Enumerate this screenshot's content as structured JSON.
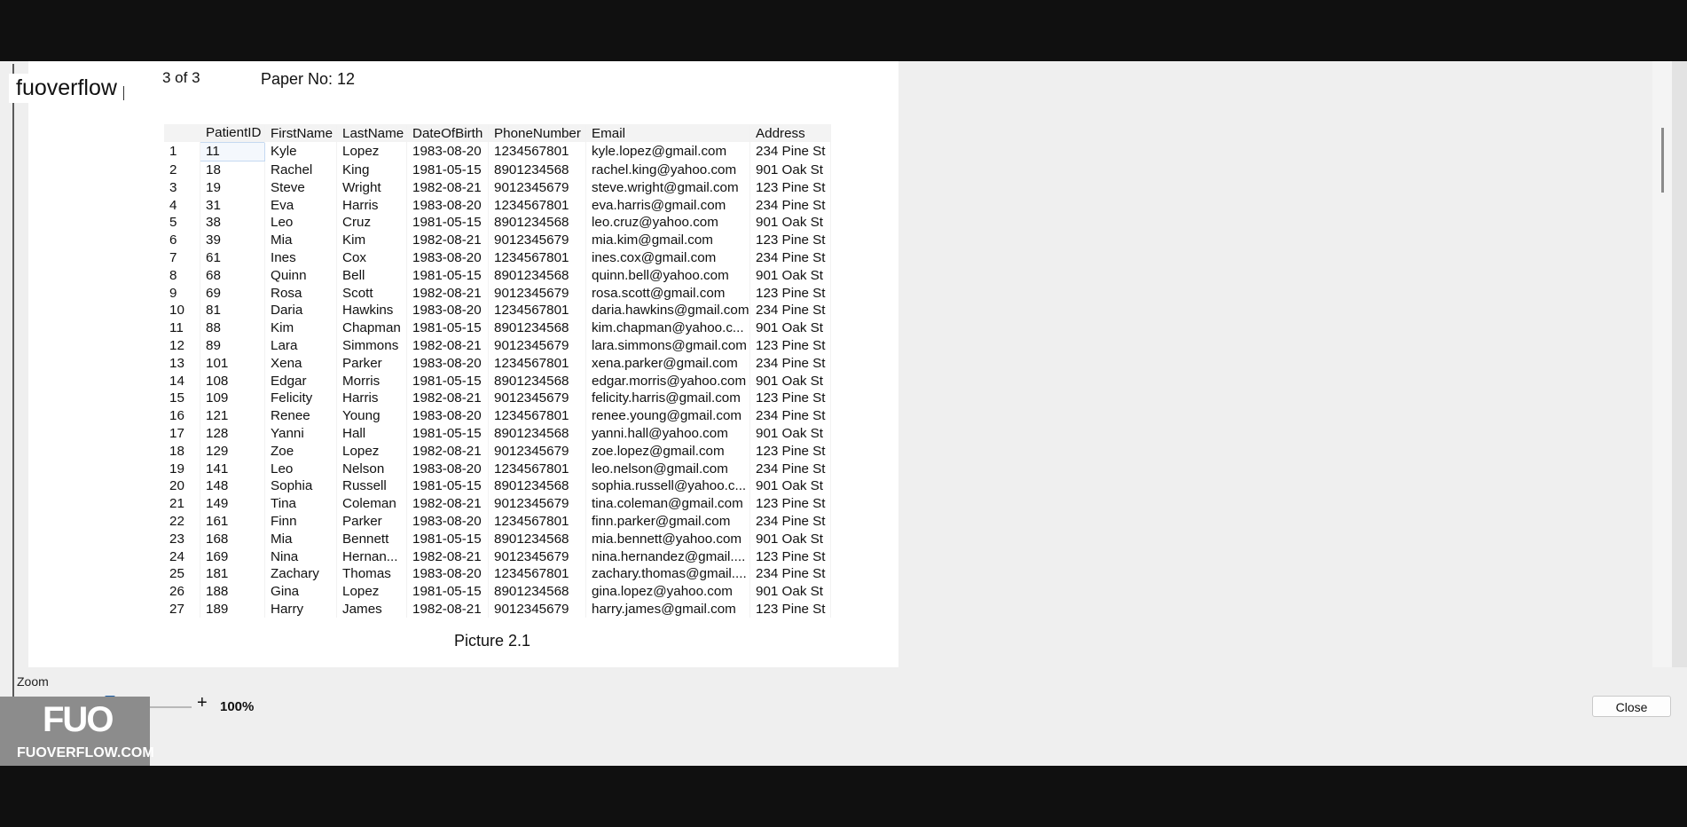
{
  "header": {
    "watermark": "fuoverflow",
    "page_count": "3 of 3",
    "paper_no": "Paper No: 12"
  },
  "table": {
    "columns": [
      "",
      "PatientID",
      "FirstName",
      "LastName",
      "DateOfBirth",
      "PhoneNumber",
      "Email",
      "Address"
    ],
    "rows": [
      [
        "1",
        "11",
        "Kyle",
        "Lopez",
        "1983-08-20",
        "1234567801",
        "kyle.lopez@gmail.com",
        "234 Pine St"
      ],
      [
        "2",
        "18",
        "Rachel",
        "King",
        "1981-05-15",
        "8901234568",
        "rachel.king@yahoo.com",
        "901 Oak St"
      ],
      [
        "3",
        "19",
        "Steve",
        "Wright",
        "1982-08-21",
        "9012345679",
        "steve.wright@gmail.com",
        "123 Pine St"
      ],
      [
        "4",
        "31",
        "Eva",
        "Harris",
        "1983-08-20",
        "1234567801",
        "eva.harris@gmail.com",
        "234 Pine St"
      ],
      [
        "5",
        "38",
        "Leo",
        "Cruz",
        "1981-05-15",
        "8901234568",
        "leo.cruz@yahoo.com",
        "901 Oak St"
      ],
      [
        "6",
        "39",
        "Mia",
        "Kim",
        "1982-08-21",
        "9012345679",
        "mia.kim@gmail.com",
        "123 Pine St"
      ],
      [
        "7",
        "61",
        "Ines",
        "Cox",
        "1983-08-20",
        "1234567801",
        "ines.cox@gmail.com",
        "234 Pine St"
      ],
      [
        "8",
        "68",
        "Quinn",
        "Bell",
        "1981-05-15",
        "8901234568",
        "quinn.bell@yahoo.com",
        "901 Oak St"
      ],
      [
        "9",
        "69",
        "Rosa",
        "Scott",
        "1982-08-21",
        "9012345679",
        "rosa.scott@gmail.com",
        "123 Pine St"
      ],
      [
        "10",
        "81",
        "Daria",
        "Hawkins",
        "1983-08-20",
        "1234567801",
        "daria.hawkins@gmail.com",
        "234 Pine St"
      ],
      [
        "11",
        "88",
        "Kim",
        "Chapman",
        "1981-05-15",
        "8901234568",
        "kim.chapman@yahoo.c...",
        "901 Oak St"
      ],
      [
        "12",
        "89",
        "Lara",
        "Simmons",
        "1982-08-21",
        "9012345679",
        "lara.simmons@gmail.com",
        "123 Pine St"
      ],
      [
        "13",
        "101",
        "Xena",
        "Parker",
        "1983-08-20",
        "1234567801",
        "xena.parker@gmail.com",
        "234 Pine St"
      ],
      [
        "14",
        "108",
        "Edgar",
        "Morris",
        "1981-05-15",
        "8901234568",
        "edgar.morris@yahoo.com",
        "901 Oak St"
      ],
      [
        "15",
        "109",
        "Felicity",
        "Harris",
        "1982-08-21",
        "9012345679",
        "felicity.harris@gmail.com",
        "123 Pine St"
      ],
      [
        "16",
        "121",
        "Renee",
        "Young",
        "1983-08-20",
        "1234567801",
        "renee.young@gmail.com",
        "234 Pine St"
      ],
      [
        "17",
        "128",
        "Yanni",
        "Hall",
        "1981-05-15",
        "8901234568",
        "yanni.hall@yahoo.com",
        "901 Oak St"
      ],
      [
        "18",
        "129",
        "Zoe",
        "Lopez",
        "1982-08-21",
        "9012345679",
        "zoe.lopez@gmail.com",
        "123 Pine St"
      ],
      [
        "19",
        "141",
        "Leo",
        "Nelson",
        "1983-08-20",
        "1234567801",
        "leo.nelson@gmail.com",
        "234 Pine St"
      ],
      [
        "20",
        "148",
        "Sophia",
        "Russell",
        "1981-05-15",
        "8901234568",
        "sophia.russell@yahoo.c...",
        "901 Oak St"
      ],
      [
        "21",
        "149",
        "Tina",
        "Coleman",
        "1982-08-21",
        "9012345679",
        "tina.coleman@gmail.com",
        "123 Pine St"
      ],
      [
        "22",
        "161",
        "Finn",
        "Parker",
        "1983-08-20",
        "1234567801",
        "finn.parker@gmail.com",
        "234 Pine St"
      ],
      [
        "23",
        "168",
        "Mia",
        "Bennett",
        "1981-05-15",
        "8901234568",
        "mia.bennett@yahoo.com",
        "901 Oak St"
      ],
      [
        "24",
        "169",
        "Nina",
        "Hernan...",
        "1982-08-21",
        "9012345679",
        "nina.hernandez@gmail....",
        "123 Pine St"
      ],
      [
        "25",
        "181",
        "Zachary",
        "Thomas",
        "1983-08-20",
        "1234567801",
        "zachary.thomas@gmail....",
        "234 Pine St"
      ],
      [
        "26",
        "188",
        "Gina",
        "Lopez",
        "1981-05-15",
        "8901234568",
        "gina.lopez@yahoo.com",
        "901 Oak St"
      ],
      [
        "27",
        "189",
        "Harry",
        "James",
        "1982-08-21",
        "9012345679",
        "harry.james@gmail.com",
        "123 Pine St"
      ]
    ]
  },
  "caption": "Picture 2.1",
  "zoom": {
    "label": "Zoom",
    "minus": "-",
    "plus": "+",
    "value": "100%",
    "slider_level": 0.48
  },
  "close_label": "Close",
  "logo": {
    "mark": "FUO",
    "text": "FUOVERFLOW.COM"
  },
  "colors": {
    "slider_thumb": "#1d5fa8",
    "frame": "#101010",
    "panel": "#efefef"
  },
  "icons": [
    "minus-icon",
    "plus-icon"
  ]
}
